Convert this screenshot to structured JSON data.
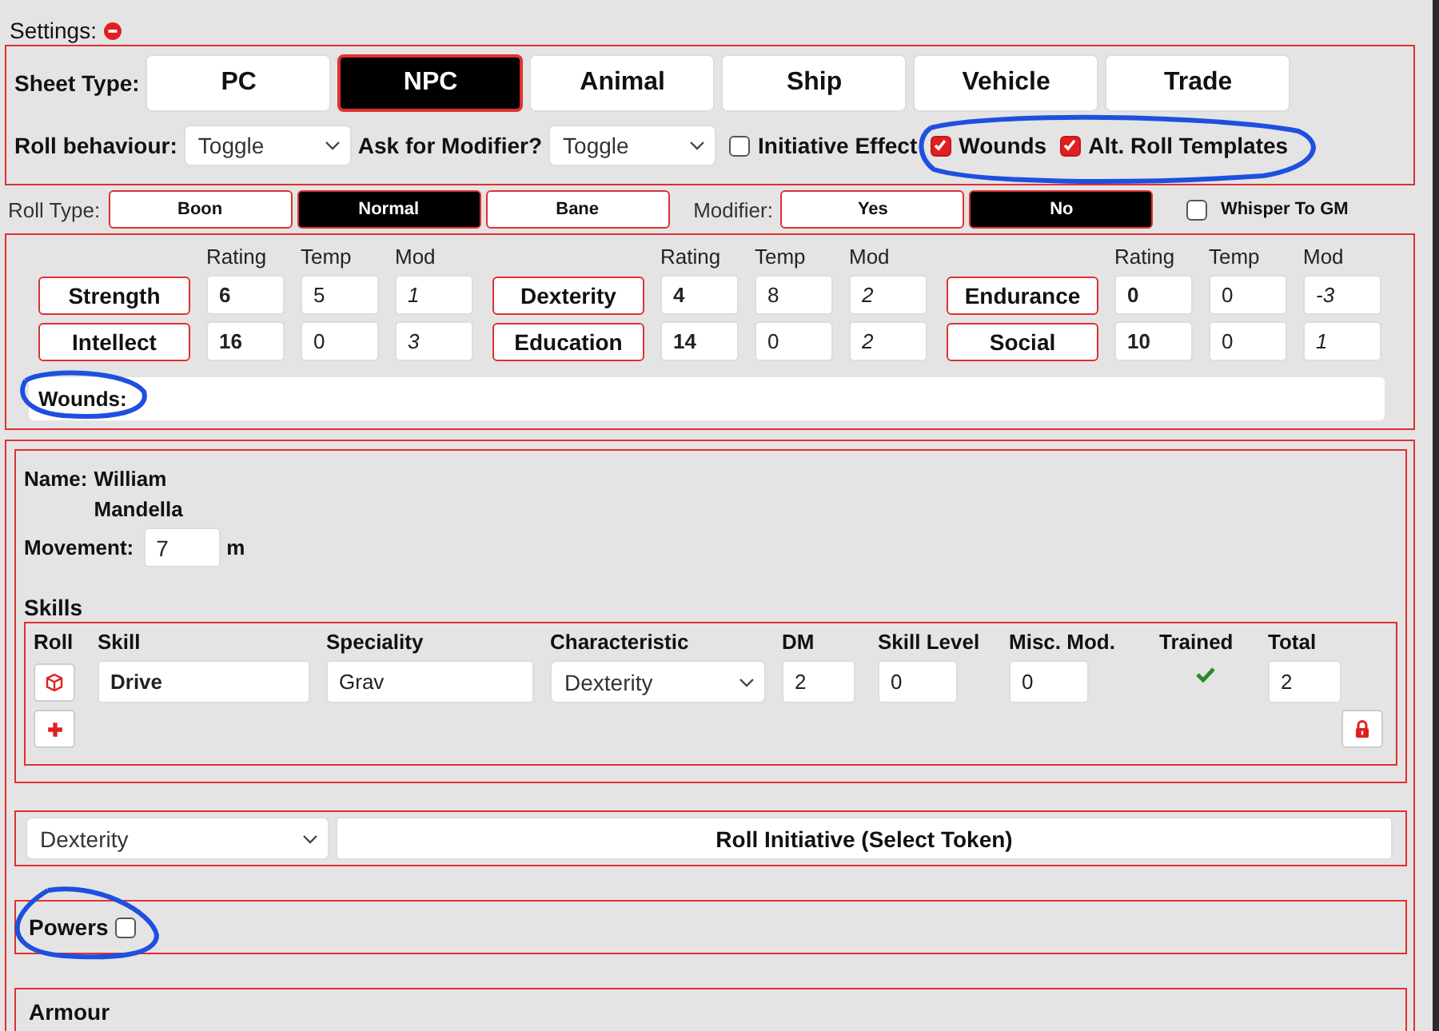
{
  "settings": {
    "label": "Settings:"
  },
  "sheet_type": {
    "label": "Sheet Type:",
    "options": [
      {
        "label": "PC",
        "selected": false
      },
      {
        "label": "NPC",
        "selected": true
      },
      {
        "label": "Animal",
        "selected": false
      },
      {
        "label": "Ship",
        "selected": false
      },
      {
        "label": "Vehicle",
        "selected": false
      },
      {
        "label": "Trade",
        "selected": false
      }
    ]
  },
  "roll_behaviour": {
    "label": "Roll behaviour:",
    "value": "Toggle"
  },
  "ask_modifier": {
    "label": "Ask for Modifier?",
    "value": "Toggle"
  },
  "toggles": [
    {
      "label": "Initiative Effect",
      "checked": false
    },
    {
      "label": "Wounds",
      "checked": true
    },
    {
      "label": "Alt. Roll Templates",
      "checked": true
    }
  ],
  "roll_type": {
    "label": "Roll Type:",
    "options": [
      {
        "label": "Boon",
        "selected": false
      },
      {
        "label": "Normal",
        "selected": true
      },
      {
        "label": "Bane",
        "selected": false
      }
    ]
  },
  "modifier": {
    "label": "Modifier:",
    "options": [
      {
        "label": "Yes",
        "selected": false
      },
      {
        "label": "No",
        "selected": true
      }
    ]
  },
  "whisper": {
    "label": "Whisper To GM",
    "checked": false
  },
  "characteristics": [
    {
      "headers": [
        "Rating",
        "Temp",
        "Mod"
      ],
      "rows": [
        {
          "name": "Strength",
          "rating": "6",
          "temp": "5",
          "mod": "1"
        },
        {
          "name": "Intellect",
          "rating": "16",
          "temp": "0",
          "mod": "3"
        }
      ]
    },
    {
      "headers": [
        "Rating",
        "Temp",
        "Mod"
      ],
      "rows": [
        {
          "name": "Dexterity",
          "rating": "4",
          "temp": "8",
          "mod": "2"
        },
        {
          "name": "Education",
          "rating": "14",
          "temp": "0",
          "mod": "2"
        }
      ]
    },
    {
      "headers": [
        "Rating",
        "Temp",
        "Mod"
      ],
      "rows": [
        {
          "name": "Endurance",
          "rating": "0",
          "temp": "0",
          "mod": "-3"
        },
        {
          "name": "Social",
          "rating": "10",
          "temp": "0",
          "mod": "1"
        }
      ]
    }
  ],
  "wounds": {
    "label": "Wounds:"
  },
  "name": {
    "label": "Name:",
    "value": "William Mandella"
  },
  "movement": {
    "label": "Movement:",
    "value": "7",
    "unit": "m"
  },
  "skills": {
    "title": "Skills",
    "columns": [
      "Roll",
      "Skill",
      "Speciality",
      "Characteristic",
      "DM",
      "Skill Level",
      "Misc. Mod.",
      "Trained",
      "Total"
    ],
    "rows": [
      {
        "skill": "Drive",
        "speciality": "Grav",
        "characteristic": "Dexterity",
        "dm": "2",
        "skill_level": "0",
        "misc_mod": "0",
        "trained": true,
        "total": "2"
      }
    ]
  },
  "initiative": {
    "characteristic": "Dexterity",
    "button": "Roll Initiative (Select Token)"
  },
  "powers": {
    "label": "Powers",
    "checked": false
  },
  "armour": {
    "title": "Armour"
  }
}
